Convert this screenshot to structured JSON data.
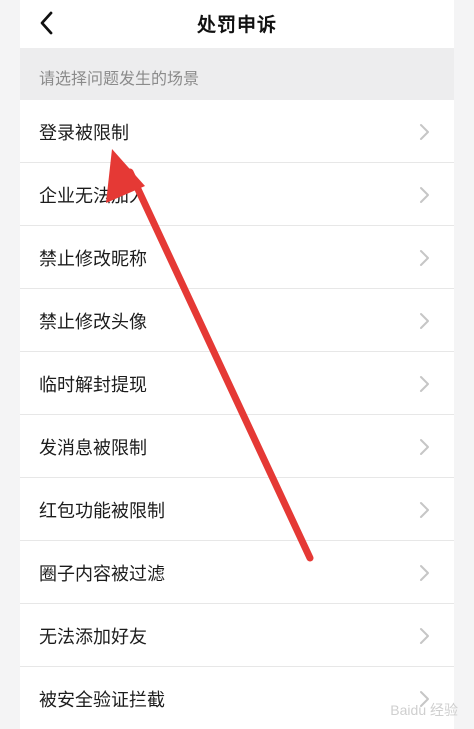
{
  "header": {
    "title": "处罚申诉"
  },
  "section": {
    "prompt": "请选择问题发生的场景"
  },
  "items": [
    {
      "label": "登录被限制"
    },
    {
      "label": "企业无法加入"
    },
    {
      "label": "禁止修改昵称"
    },
    {
      "label": "禁止修改头像"
    },
    {
      "label": "临时解封提现"
    },
    {
      "label": "发消息被限制"
    },
    {
      "label": "红包功能被限制"
    },
    {
      "label": "圈子内容被过滤"
    },
    {
      "label": "无法添加好友"
    },
    {
      "label": "被安全验证拦截"
    }
  ],
  "watermark": "Baidu 经验",
  "icons": {
    "back": "chevron-left-icon",
    "row": "chevron-right-icon"
  },
  "colors": {
    "page_background": "#f4f4f5",
    "list_background": "#ffffff",
    "arrow": "#e53935"
  }
}
